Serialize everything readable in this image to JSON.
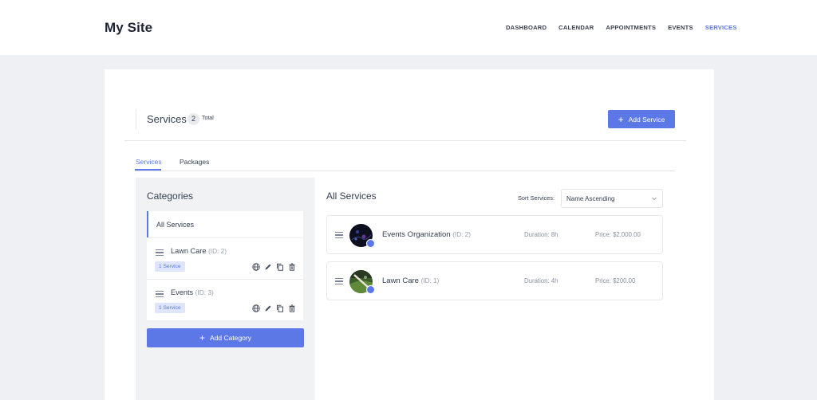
{
  "header": {
    "site_title": "My Site",
    "nav": [
      {
        "label": "DASHBOARD",
        "active": false
      },
      {
        "label": "CALENDAR",
        "active": false
      },
      {
        "label": "APPOINTMENTS",
        "active": false
      },
      {
        "label": "EVENTS",
        "active": false
      },
      {
        "label": "SERVICES",
        "active": true
      }
    ]
  },
  "page": {
    "title": "Services",
    "count": "2",
    "count_suffix": "Total",
    "add_service_label": "Add Service"
  },
  "tabs": [
    {
      "label": "Services",
      "active": true
    },
    {
      "label": "Packages",
      "active": false
    }
  ],
  "categories": {
    "heading": "Categories",
    "all_label": "All Services",
    "items": [
      {
        "name": "Lawn Care",
        "id_text": "(ID: 2)",
        "badge": "1 Service"
      },
      {
        "name": "Events",
        "id_text": "(ID: 3)",
        "badge": "1 Service"
      }
    ],
    "add_label": "Add Category"
  },
  "services": {
    "heading": "All Services",
    "sort_label": "Sort Services:",
    "sort_value": "Name Ascending",
    "items": [
      {
        "name": "Events Organization",
        "id_text": "(ID: 2)",
        "duration": "Duration: 8h",
        "price": "Price: $2,000.00",
        "thumb": "events-thumbnail"
      },
      {
        "name": "Lawn Care",
        "id_text": "(ID: 1)",
        "duration": "Duration: 4h",
        "price": "Price: $200.00",
        "thumb": "lawn-thumbnail"
      }
    ]
  },
  "colors": {
    "accent": "#5b78e6",
    "background": "#eef0f3",
    "badge_bg": "#dfe5fb",
    "text": "#354052"
  }
}
